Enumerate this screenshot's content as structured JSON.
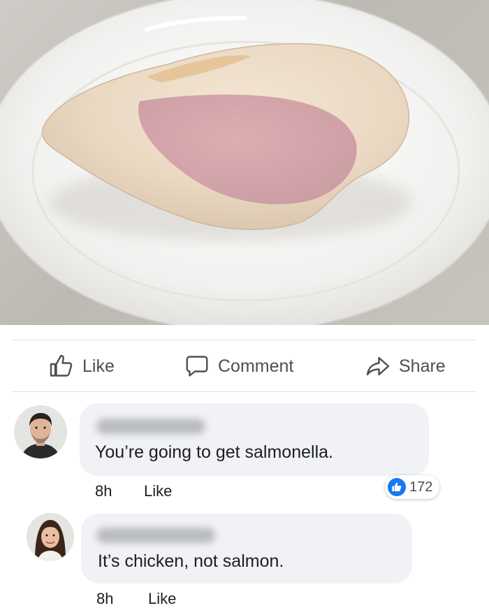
{
  "post": {
    "photo_description_icon": "chicken-breast-photo"
  },
  "actions": {
    "like_label": "Like",
    "comment_label": "Comment",
    "share_label": "Share"
  },
  "comments": [
    {
      "text": "You’re going to get salmonella.",
      "time": "8h",
      "like_label": "Like",
      "reaction_count": "172"
    },
    {
      "text": "It’s chicken, not salmon.",
      "time": "8h",
      "like_label": "Like"
    }
  ],
  "colors": {
    "accent": "#1877f2",
    "bubble": "#f0f2f5",
    "text": "#1c1e21",
    "muted": "#4b4f56"
  }
}
